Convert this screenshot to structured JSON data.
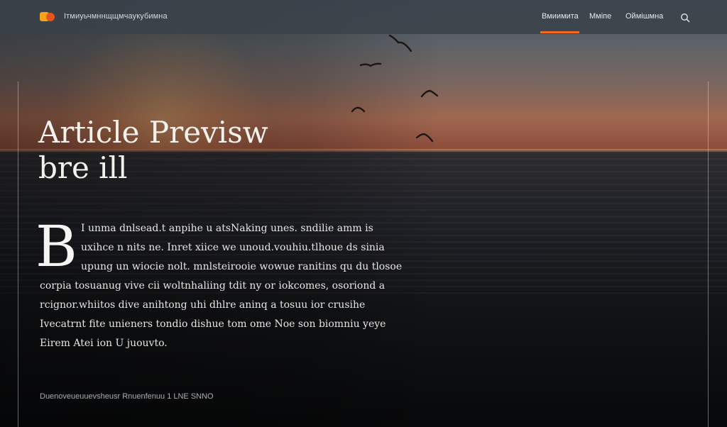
{
  "header": {
    "brand": "Ітмиуьчмннщщмчаукубимна",
    "nav": [
      "Вмиимита",
      "Мміпе",
      "Оймішмна"
    ],
    "active_nav_index": 0,
    "accent_color": "#f26a21",
    "logo_icon": "logo-icon",
    "search_icon": "search-icon"
  },
  "article": {
    "headline_line1": "Article Previsw",
    "headline_line2": "bre ill",
    "dropcap": "B",
    "body_lines": [
      "I unma  dnlsead.t anpihe u  atsNaking unes. sndilie amm  is",
      "uxihce n nits ne. Inret xiice  we  unoud.vouhiu.tlhoue  ds  sinia",
      "upung un wiocie  nolt.  mnlsteirooie   wowue  ranitins  qu du  tlosoe",
      "corpia  tosuanug  vive  cii  woltnhaliing  tdit  ny  or iokcomes,  osoriond a",
      "rcignor.whiitos  dive  anihtong  uhi dhlre  aninq  a  tosuu  ior  crusihe",
      "Ivecatrnt  fite  unieners  tondio dishue  tom  ome  Noe  son biomniu  yeye",
      "Eirem  Atei  ion  U  juouvto."
    ],
    "meta": "Duenoveueuuevsheusr  Rnuenfenuu  1 LNE SNNO"
  }
}
